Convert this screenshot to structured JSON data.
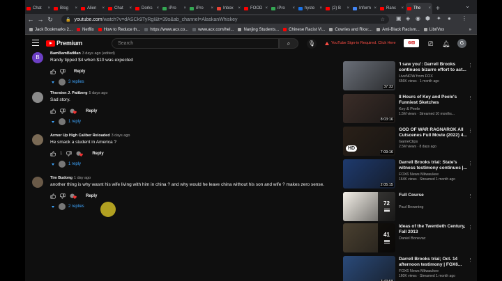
{
  "browser": {
    "tabs": [
      {
        "label": "Chat",
        "color": "#ff0000"
      },
      {
        "label": "Blog",
        "color": "#ff0000"
      },
      {
        "label": "Alien",
        "color": "#ff0000"
      },
      {
        "label": "Chat",
        "color": "#ff0000"
      },
      {
        "label": "Dorks",
        "color": "#ff0000"
      },
      {
        "label": "iPro",
        "color": "#34a853"
      },
      {
        "label": "iPro",
        "color": "#34a853"
      },
      {
        "label": "Inbox",
        "color": "#ea4335"
      },
      {
        "label": "FOOD",
        "color": "#ff0000"
      },
      {
        "label": "iPro",
        "color": "#34a853"
      },
      {
        "label": "hyste",
        "color": "#1a73e8"
      },
      {
        "label": "(2) B",
        "color": "#ff0000"
      },
      {
        "label": "Inform",
        "color": "#4285f4"
      },
      {
        "label": "Ranc",
        "color": "#ff0000"
      },
      {
        "label": "The",
        "color": "#ff0000",
        "active": true
      }
    ],
    "url_host": "youtube.com",
    "url_path": "/watch?v=dASCk9TyRgI&t=39s&ab_channel=AlaskanWhiskey",
    "bookmarks": [
      {
        "label": "Jack Bookmarks 2...",
        "color": "#aaaaaa"
      },
      {
        "label": "Netflix",
        "color": "#e50914"
      },
      {
        "label": "How to Reduce th...",
        "color": "#ff0000"
      },
      {
        "label": "https://www.acx.co...",
        "color": "#5f6368"
      },
      {
        "label": "www.acx.com/hel...",
        "color": "#5f6368"
      },
      {
        "label": "Nanjing Students...",
        "color": "#aaaaaa"
      },
      {
        "label": "Chinese Racist Vi...",
        "color": "#ff0000"
      },
      {
        "label": "Cowries and Rice:...",
        "color": "#aaaaaa"
      },
      {
        "label": "Anti-Black Racism...",
        "color": "#aaaaaa"
      },
      {
        "label": "LibriVox",
        "color": "#aaaaaa"
      }
    ],
    "other_bookmarks": "»"
  },
  "youtube": {
    "logo_text": "Premium",
    "search_placeholder": "Search",
    "error_text": "YouTube Sign-in Required. Click Here",
    "avatar_letter": "G"
  },
  "comments": [
    {
      "author": "BamBamBatMan",
      "time": "3 days ago (edited)",
      "text": "Randy tipped $4 when $10 was expected",
      "likes": "",
      "reply_label": "Reply",
      "replies_label": "3 replies",
      "avatar_color": "#6c3fc4",
      "avatar_letter": "B"
    },
    {
      "author": "Thorsten J. Pattberg",
      "time": "5 days ago",
      "text": "Sad story.",
      "likes": "",
      "reply_label": "Reply",
      "replies_label": "1 reply",
      "avatar_color": "#8a8a8a",
      "avatar_letter": ""
    },
    {
      "author": "Armor Up High Caliber Reloaded",
      "time": "3 days ago",
      "text": "He smack a student in America ?",
      "likes": "1",
      "reply_label": "Reply",
      "replies_label": "1 reply",
      "avatar_color": "#7a6a55",
      "avatar_letter": ""
    },
    {
      "author": "Tim Budong",
      "time": "1 day ago",
      "text": "another thing is why wasnt his wife living with him in china ? and why would he leave china without his son and wife ? makes zero sense.",
      "likes": "",
      "reply_label": "Reply",
      "replies_label": "2 replies",
      "avatar_color": "#6a5a48",
      "avatar_letter": ""
    }
  ],
  "sidebar": [
    {
      "title": "'I saw you': Darrell Brooks continues bizarre effort to act...",
      "channel": "LiveNOW from FOX",
      "meta": "656K views · 1 month ago",
      "duration": "37:32",
      "thumb": "#6a6f78",
      "type": "video"
    },
    {
      "title": "8 Hours of Key and Peele's Funniest Sketches",
      "channel": "Key & Peele",
      "meta": "1.5M views · Streamed 10 months...",
      "duration": "8:03:16",
      "thumb": "#3b2d28",
      "type": "video"
    },
    {
      "title": "GOD OF WAR RAGNAROK All Cutscenes Full Movie (2022) 4...",
      "channel": "GameClips",
      "meta": "2.5M views · 8 days ago",
      "duration": "7:09:16",
      "thumb": "#2a2018",
      "type": "video",
      "badge": "HD"
    },
    {
      "title": "Darrell Brooks trial: State's witness testimony continues |...",
      "channel": "FOX6 News Milwaukee",
      "meta": "164K views · Streamed 1 month ago",
      "duration": "2:05:15",
      "thumb": "#1e3a6e",
      "type": "video"
    },
    {
      "title": "Full Course",
      "channel": "Paul Browning",
      "meta": "",
      "count": "72",
      "thumb": "#f4f0e8",
      "type": "playlist"
    },
    {
      "title": "Ideas of the Twentieth Century, Fall 2013",
      "channel": "Daniel Bonevac",
      "meta": "",
      "count": "41",
      "thumb": "#4a4030",
      "type": "playlist"
    },
    {
      "title": "Darrell Brooks trial; Oct. 14 afternoon testimony | FOX6...",
      "channel": "FOX6 News Milwaukee",
      "meta": "160K views · Streamed 1 month ago",
      "duration": "3:43:58",
      "thumb": "#2a4a7a",
      "type": "video"
    }
  ]
}
